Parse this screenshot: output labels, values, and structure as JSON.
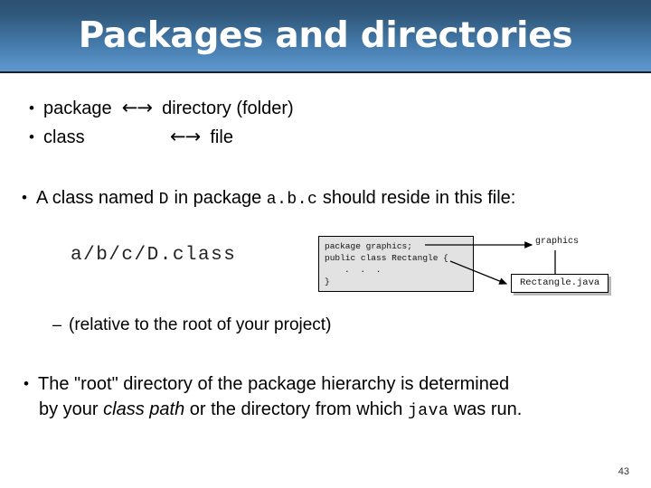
{
  "slide": {
    "title": "Packages and directories",
    "page_number": "43",
    "bullets": {
      "package_left": "package",
      "package_arrow": "←→",
      "package_right": "directory (folder)",
      "class_left": "class",
      "class_arrow": "←→",
      "class_right": "file",
      "named_part1": "A class named ",
      "named_code1": "D",
      "named_part2": " in package ",
      "named_code2": "a.b.c",
      "named_part3": " should reside in this file:",
      "relative": "(relative to the root of your project)",
      "root_part1": "The \"root\" directory of the package hierarchy is determined",
      "root_part2": "by your ",
      "root_italic": "class path",
      "root_part3": " or the directory from which ",
      "root_code": "java",
      "root_part4": " was run."
    },
    "path_sample": "a/b/c/D.class",
    "diagram": {
      "code_line1": "package graphics;",
      "code_line2": "public class Rectangle {",
      "code_line3": ". . .",
      "code_line4": "}",
      "graphics_label": "graphics",
      "file_label": "Rectangle.java"
    }
  },
  "colors": {
    "banner_top": "#2b4f70",
    "banner_bottom": "#5e96cb",
    "code_box_bg": "#e2e2e2",
    "shadow": "#b9b9b9"
  }
}
